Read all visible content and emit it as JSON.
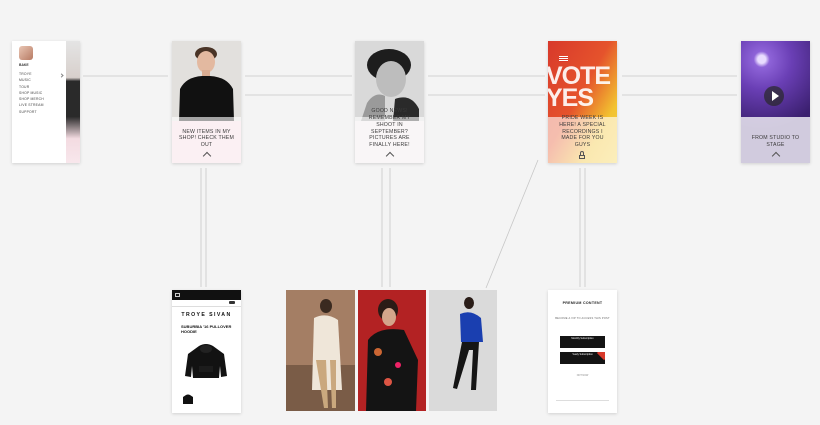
{
  "menu_screen": {
    "name": "BAKE",
    "items": [
      "TROYE",
      "MUSIC",
      "TOUR",
      "SHOP MUSIC",
      "SHOP MERCH",
      "LIVE STREAM",
      "SUPPORT"
    ]
  },
  "screens": [
    {
      "caption": "NEW ITEMS IN MY SHOP! CHECK THEM OUT"
    },
    {
      "caption": "GOOD NEWS! REMEMBER MY SHOOT IN SEPTEMBER? PICTURES ARE FINALLY HERE!"
    },
    {
      "caption": "PRIDE WEEK IS HERE! A SPECIAL RECORDINGS I MADE FOR YOU GUYS",
      "poster_text": "VOTE YES"
    },
    {
      "caption": "FROM STUDIO TO STAGE"
    }
  ],
  "shop_screen": {
    "brand": "TROYE SIVAN",
    "product_title": "SUBURBIA '16 PULLOVER HOODIE"
  },
  "premium_screen": {
    "title": "PREMIUM CONTENT",
    "subtitle": "BECOME A VIP TO ACCESS THIS POST",
    "option_1": "Monthly Subscription",
    "option_2": "Yearly Subscription",
    "footer_link": "NOT NOW"
  },
  "colors": {
    "background": "#f4f4f4",
    "connector": "#c7c7c7",
    "vote_red": "#d8392b",
    "vote_yellow": "#f2c230",
    "stage_purple": "#6a3fb5",
    "blazer_blue": "#1a3fb0"
  },
  "icons": [
    "avatar-icon",
    "chevron-up-icon",
    "play-icon",
    "lock-icon",
    "hoodie-icon"
  ]
}
